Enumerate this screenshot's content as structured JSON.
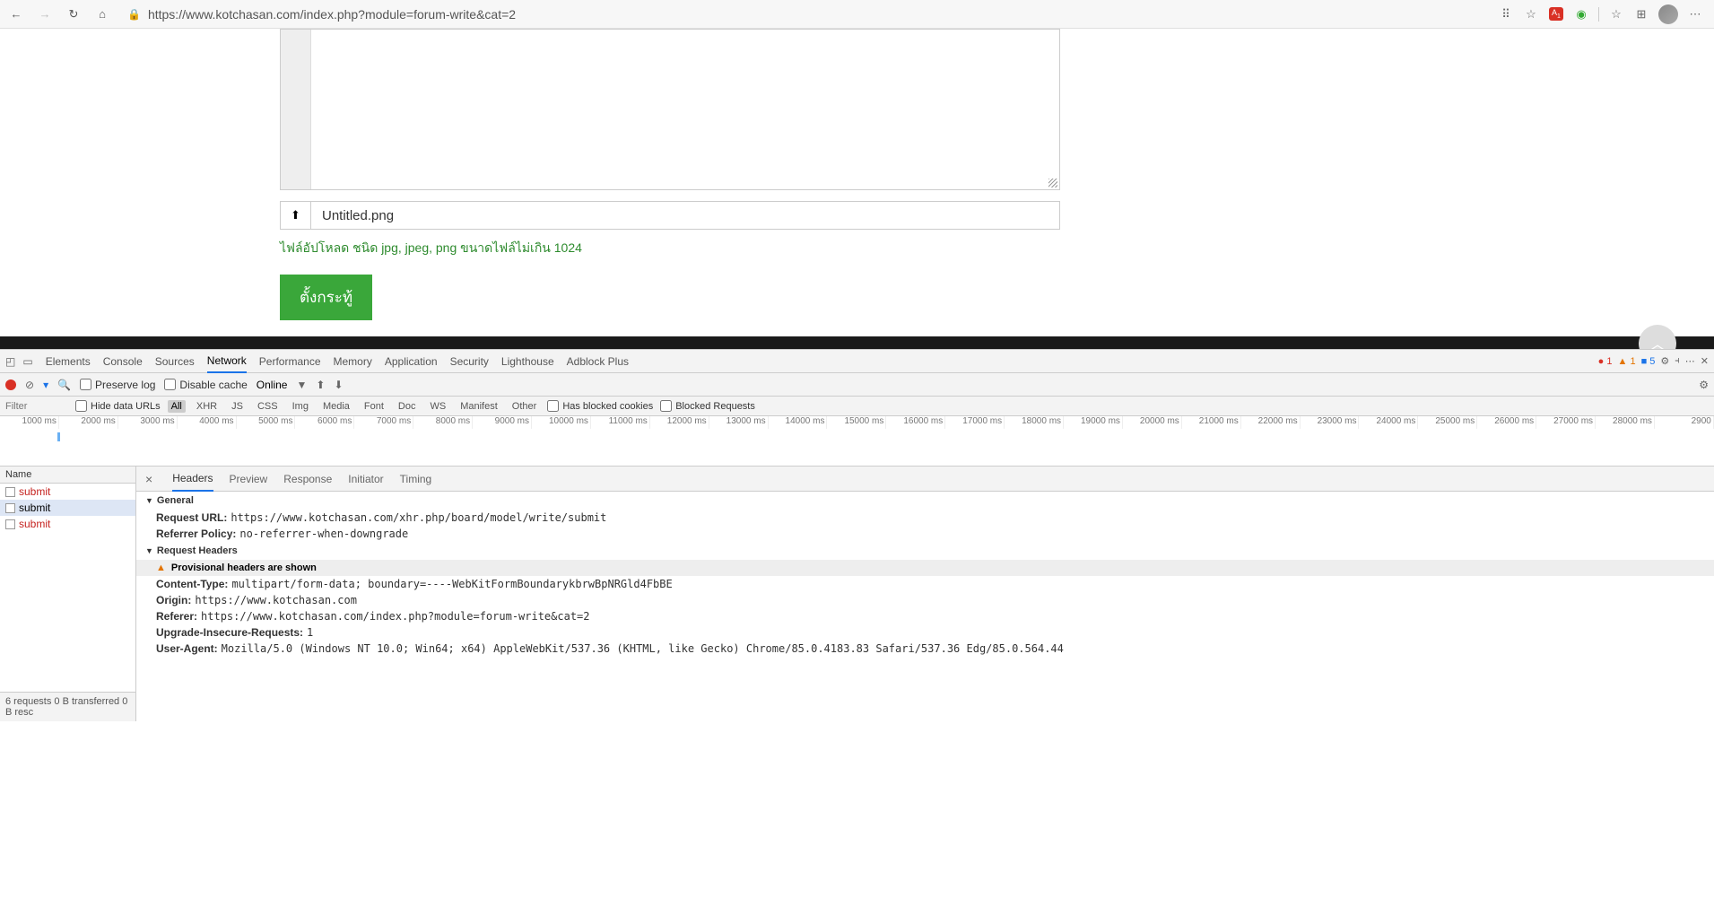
{
  "browser": {
    "url": "https://www.kotchasan.com/index.php?module=forum-write&cat=2"
  },
  "page": {
    "upload_filename": "Untitled.png",
    "upload_hint": "ไฟล์อัปโหลด ชนิด jpg, jpeg, png ขนาดไฟล์ไม่เกิน 1024",
    "submit_label": "ตั้งกระทู้"
  },
  "devtools": {
    "tabs": [
      "Elements",
      "Console",
      "Sources",
      "Network",
      "Performance",
      "Memory",
      "Application",
      "Security",
      "Lighthouse",
      "Adblock Plus"
    ],
    "active_tab": "Network",
    "status": {
      "errors": "1",
      "warnings": "1",
      "info": "5"
    },
    "toolbar": {
      "preserve_log": "Preserve log",
      "disable_cache": "Disable cache",
      "online": "Online"
    },
    "filter": {
      "placeholder": "Filter",
      "hide_data_urls": "Hide data URLs",
      "types": [
        "All",
        "XHR",
        "JS",
        "CSS",
        "Img",
        "Media",
        "Font",
        "Doc",
        "WS",
        "Manifest",
        "Other"
      ],
      "has_blocked_cookies": "Has blocked cookies",
      "blocked_requests": "Blocked Requests"
    },
    "timeline_ticks": [
      "1000 ms",
      "2000 ms",
      "3000 ms",
      "4000 ms",
      "5000 ms",
      "6000 ms",
      "7000 ms",
      "8000 ms",
      "9000 ms",
      "10000 ms",
      "11000 ms",
      "12000 ms",
      "13000 ms",
      "14000 ms",
      "15000 ms",
      "16000 ms",
      "17000 ms",
      "18000 ms",
      "19000 ms",
      "20000 ms",
      "21000 ms",
      "22000 ms",
      "23000 ms",
      "24000 ms",
      "25000 ms",
      "26000 ms",
      "27000 ms",
      "28000 ms",
      "2900"
    ],
    "requests": {
      "header": "Name",
      "items": [
        {
          "name": "submit",
          "color": "red"
        },
        {
          "name": "submit",
          "color": "black",
          "selected": true
        },
        {
          "name": "submit",
          "color": "red"
        }
      ],
      "footer": "6 requests  0 B transferred  0 B resc"
    },
    "detail_tabs": [
      "Headers",
      "Preview",
      "Response",
      "Initiator",
      "Timing"
    ],
    "detail_active": "Headers",
    "general_label": "General",
    "request_headers_label": "Request Headers",
    "provisional": "Provisional headers are shown",
    "headers": {
      "request_url_k": "Request URL:",
      "request_url_v": "https://www.kotchasan.com/xhr.php/board/model/write/submit",
      "referrer_policy_k": "Referrer Policy:",
      "referrer_policy_v": "no-referrer-when-downgrade",
      "content_type_k": "Content-Type:",
      "content_type_v": "multipart/form-data; boundary=----WebKitFormBoundarykbrwBpNRGld4FbBE",
      "origin_k": "Origin:",
      "origin_v": "https://www.kotchasan.com",
      "referer_k": "Referer:",
      "referer_v": "https://www.kotchasan.com/index.php?module=forum-write&cat=2",
      "upgrade_k": "Upgrade-Insecure-Requests:",
      "upgrade_v": "1",
      "ua_k": "User-Agent:",
      "ua_v": "Mozilla/5.0 (Windows NT 10.0; Win64; x64) AppleWebKit/537.36 (KHTML, like Gecko) Chrome/85.0.4183.83 Safari/537.36 Edg/85.0.564.44"
    }
  }
}
